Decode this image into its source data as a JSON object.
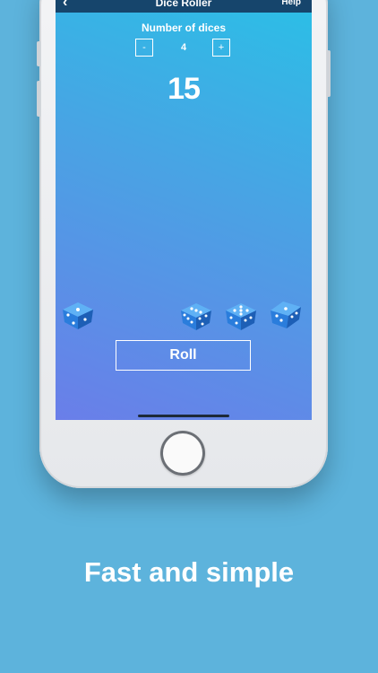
{
  "navbar": {
    "back_icon": "chevron-left-icon",
    "title": "Dice Roller",
    "help_label": "Help"
  },
  "dice_count": {
    "label": "Number of dices",
    "decrement_label": "-",
    "value": "4",
    "increment_label": "+"
  },
  "total": "15",
  "dice": [
    {
      "name": "die-1",
      "icon": "dice-icon"
    },
    {
      "name": "die-2",
      "icon": "dice-icon"
    },
    {
      "name": "die-3",
      "icon": "dice-icon"
    },
    {
      "name": "die-4",
      "icon": "dice-icon"
    }
  ],
  "roll_label": "Roll",
  "tagline": "Fast and simple",
  "colors": {
    "background": "#5db3dc",
    "navbar": "#16456c",
    "gradient_top": "#2bbfe6",
    "gradient_bottom": "#6a7ee9",
    "die_blue": "#2a7ddc"
  }
}
